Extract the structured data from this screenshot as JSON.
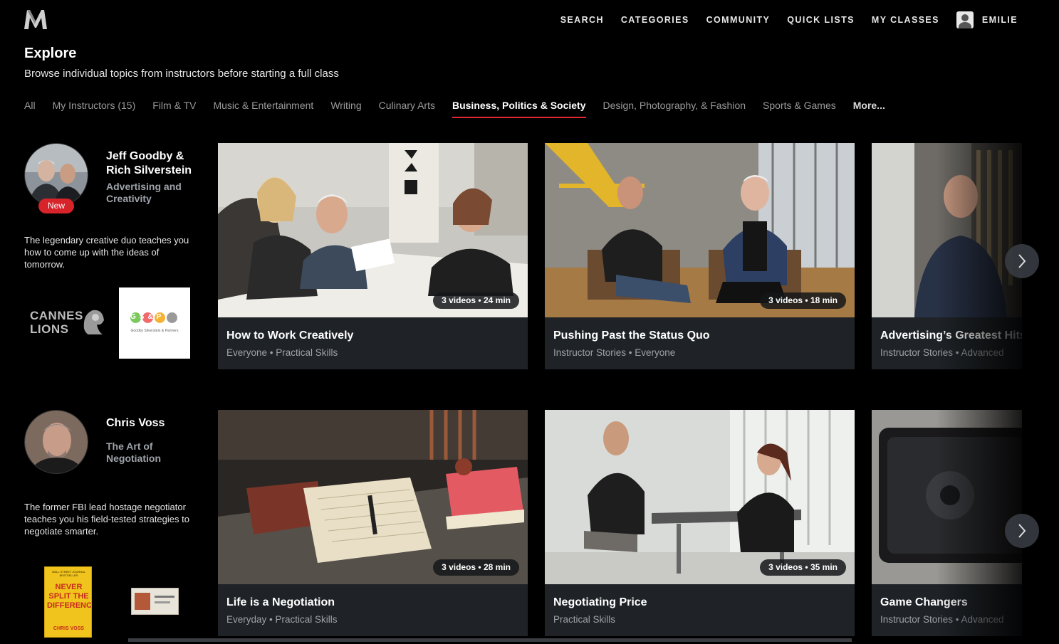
{
  "nav": {
    "logo": "M",
    "items": [
      "SEARCH",
      "CATEGORIES",
      "COMMUNITY",
      "QUICK LISTS",
      "MY CLASSES"
    ],
    "user_name": "EMILIE"
  },
  "header": {
    "title": "Explore",
    "subtitle": "Browse individual topics from instructors before starting a full class"
  },
  "tabs": [
    {
      "label": "All"
    },
    {
      "label": "My Instructors (15)"
    },
    {
      "label": "Film & TV"
    },
    {
      "label": "Music & Entertainment"
    },
    {
      "label": "Writing"
    },
    {
      "label": "Culinary Arts"
    },
    {
      "label": "Business, Politics & Society",
      "active": true
    },
    {
      "label": "Design, Photography, & Fashion"
    },
    {
      "label": "Sports & Games"
    },
    {
      "label": "More..."
    }
  ],
  "rows": [
    {
      "instructor": {
        "name": "Jeff Goodby & Rich Silverstein",
        "topic": "Advertising and Creativity",
        "badge": "New",
        "description": "The legendary creative duo teaches you how to come up with the ideas of tomorrow.",
        "logos": [
          "CANNES LIONS",
          "GS&P",
          "Goodby Silverstein & Partners"
        ]
      },
      "cards": [
        {
          "title": "How to Work Creatively",
          "meta": "Everyone • Practical Skills",
          "duration": "3 videos • 24 min"
        },
        {
          "title": "Pushing Past the Status Quo",
          "meta": "Instructor Stories • Everyone",
          "duration": "3 videos • 18 min"
        },
        {
          "title": "Advertising’s Greatest Hits",
          "meta": "Instructor Stories • Advanced"
        }
      ]
    },
    {
      "instructor": {
        "name": "Chris Voss",
        "topic": "The Art of Negotiation",
        "description": "The former FBI lead hostage negotiator teaches you his field-tested strategies to negotiate smarter.",
        "book": {
          "top": "WALL STREET JOURNAL BESTSELLER",
          "title": "NEVER SPLIT THE DIFFERENCE",
          "author": "CHRIS VOSS"
        }
      },
      "cards": [
        {
          "title": "Life is a Negotiation",
          "meta": "Everyday • Practical Skills",
          "duration": "3 videos • 28 min"
        },
        {
          "title": "Negotiating Price",
          "meta": "Practical Skills",
          "duration": "3 videos • 35 min"
        },
        {
          "title": "Game Changers",
          "meta": "Instructor Stories • Advanced"
        }
      ]
    }
  ]
}
